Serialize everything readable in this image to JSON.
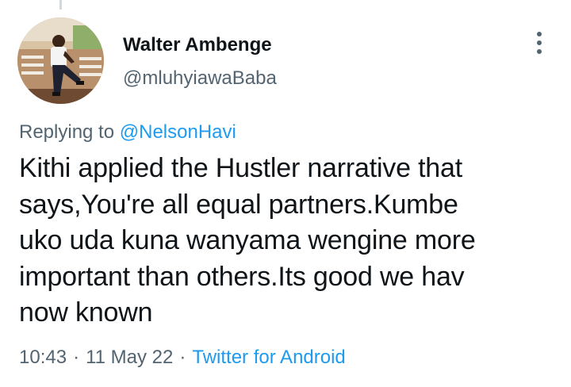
{
  "author": {
    "display_name": "Walter Ambenge",
    "handle": "@mluhyiawaBaba",
    "avatar_icon": "profile-photo"
  },
  "more_icon": "more-vertical-icon",
  "reply_context": {
    "prefix": "Replying to",
    "mention": "@NelsonHavi"
  },
  "tweet": {
    "lines": [
      "Kithi applied the Hustler narrative that",
      "says,You're all equal partners.Kumbe",
      "uko uda kuna wanyama wengine more",
      "important than others.Its good we hav",
      "now known"
    ]
  },
  "meta": {
    "time": "10:43",
    "separator": "·",
    "date": "11 May 22",
    "source": "Twitter for Android"
  },
  "colors": {
    "text_primary": "#0f1419",
    "text_secondary": "#536471",
    "link_blue": "#1d9bf0",
    "thread_line": "#cfd9de"
  }
}
